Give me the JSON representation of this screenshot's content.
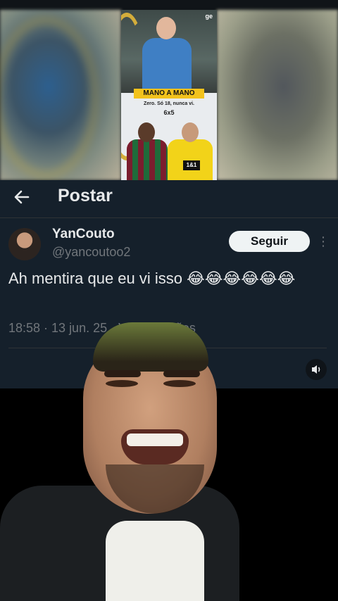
{
  "video": {
    "thumbnail": {
      "channel_logo": "ge",
      "banner": "MANO A MANO",
      "subtitle": "Zero. Só 18, nunca vi.",
      "score": "6x5",
      "sponsor_tag": "1&1"
    }
  },
  "post_screen": {
    "header": {
      "back_icon": "arrow-left-icon",
      "title": "Postar"
    },
    "author": {
      "name": "YanCouto",
      "handle": "@yancoutoo2",
      "follow_label": "Seguir",
      "more_icon": "vertical-dots-icon"
    },
    "tweet_text": "Ah mentira que eu vi isso 😂😂😂😂😂😂",
    "meta": "18:58 · 13 jun. 25 · ",
    "meta_views": "Visualizações",
    "sound_icon": "speaker-icon"
  },
  "colors": {
    "panel_bg": "#15202b",
    "text_primary": "#e7e9ea",
    "text_secondary": "#71767b",
    "follow_bg": "#eff3f4"
  }
}
